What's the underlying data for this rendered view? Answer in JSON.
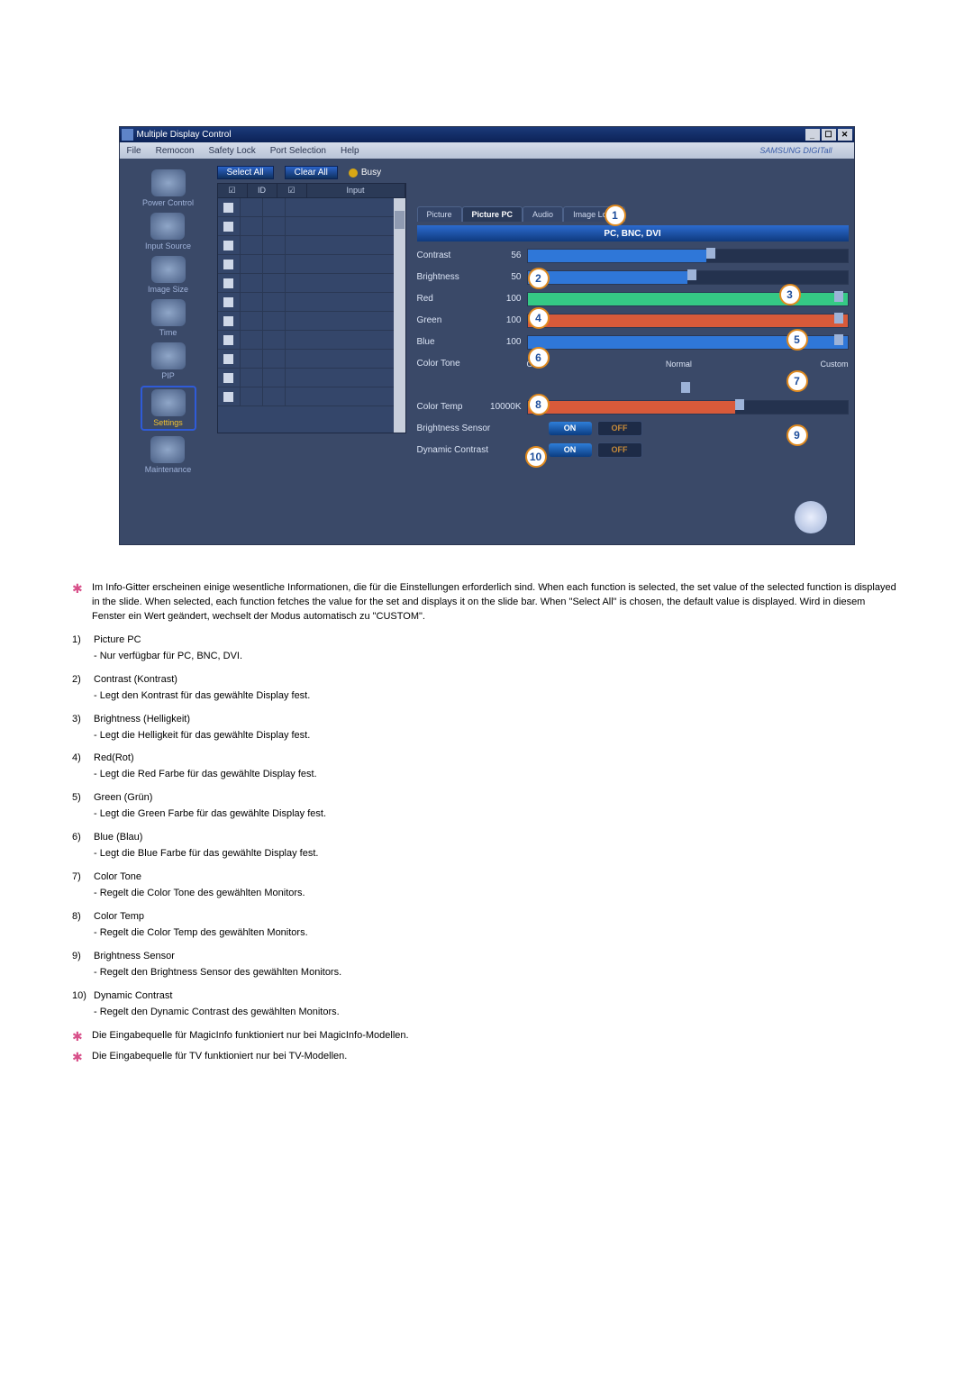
{
  "window": {
    "title": "Multiple Display Control",
    "brand": "SAMSUNG DIGITall"
  },
  "menu": {
    "file": "File",
    "remocon": "Remocon",
    "safety": "Safety Lock",
    "port": "Port Selection",
    "help": "Help"
  },
  "sidebar": {
    "items": [
      {
        "label": "Power Control"
      },
      {
        "label": "Input Source"
      },
      {
        "label": "Image Size"
      },
      {
        "label": "Time"
      },
      {
        "label": "PIP"
      },
      {
        "label": "Settings"
      },
      {
        "label": "Maintenance"
      }
    ]
  },
  "cmd": {
    "selectAll": "Select All",
    "clearAll": "Clear All",
    "busy": "Busy"
  },
  "grid": {
    "head": {
      "chk": "☑",
      "id": "ID",
      "st": "☑",
      "input": "Input"
    }
  },
  "tabs": {
    "picture": "Picture",
    "picturePC": "Picture PC",
    "audio": "Audio",
    "imageLock": "Image Lock"
  },
  "sub": "PC, BNC, DVI",
  "sliders": {
    "contrast": {
      "label": "Contrast",
      "val": "56"
    },
    "brightness": {
      "label": "Brightness",
      "val": "50"
    },
    "red": {
      "label": "Red",
      "val": "100"
    },
    "green": {
      "label": "Green",
      "val": "100"
    },
    "blue": {
      "label": "Blue",
      "val": "100"
    },
    "colorTone": {
      "label": "Color Tone",
      "off": "Off",
      "normal": "Normal",
      "custom": "Custom"
    },
    "colorTemp": {
      "label": "Color Temp",
      "val": "10000K"
    }
  },
  "toggles": {
    "bs": {
      "label": "Brightness Sensor",
      "on": "ON",
      "off": "OFF"
    },
    "dc": {
      "label": "Dynamic Contrast",
      "on": "ON",
      "off": "OFF"
    }
  },
  "callouts": {
    "1": "1",
    "2": "2",
    "3": "3",
    "4": "4",
    "5": "5",
    "6": "6",
    "7": "7",
    "8": "8",
    "9": "9",
    "10": "10"
  },
  "notes": {
    "intro": "Im Info-Gitter erscheinen einige wesentliche Informationen, die für die Einstellungen erforderlich sind. When each function is selected, the set value of the selected function is displayed in the slide. When selected, each function fetches the value for the set and displays it on the slide bar. When \"Select All\" is chosen, the default value is displayed. Wird in diesem Fenster ein Wert geändert, wechselt der Modus automatisch zu \"CUSTOM\".",
    "items": [
      {
        "n": "1)",
        "t": "Picture PC",
        "s": "- Nur verfügbar für PC, BNC, DVI."
      },
      {
        "n": "2)",
        "t": "Contrast (Kontrast)",
        "s": "- Legt den Kontrast für das gewählte Display fest."
      },
      {
        "n": "3)",
        "t": "Brightness (Helligkeit)",
        "s": "- Legt die Helligkeit für das gewählte Display fest."
      },
      {
        "n": "4)",
        "t": "Red(Rot)",
        "s": "- Legt die Red Farbe für das gewählte Display fest."
      },
      {
        "n": "5)",
        "t": "Green (Grün)",
        "s": "- Legt die Green Farbe für das gewählte Display fest."
      },
      {
        "n": "6)",
        "t": "Blue (Blau)",
        "s": "- Legt die Blue Farbe für das gewählte Display fest."
      },
      {
        "n": "7)",
        "t": "Color Tone",
        "s": "- Regelt die Color Tone des gewählten Monitors."
      },
      {
        "n": "8)",
        "t": "Color Temp",
        "s": "- Regelt die Color Temp des gewählten Monitors."
      },
      {
        "n": "9)",
        "t": "Brightness Sensor",
        "s": "- Regelt den Brightness Sensor des gewählten Monitors."
      },
      {
        "n": "10)",
        "t": "Dynamic Contrast",
        "s": "- Regelt den Dynamic Contrast des gewählten Monitors."
      }
    ],
    "foot1": "Die Eingabequelle für MagicInfo funktioniert nur bei MagicInfo-Modellen.",
    "foot2": "Die Eingabequelle für TV funktioniert nur bei TV-Modellen."
  }
}
